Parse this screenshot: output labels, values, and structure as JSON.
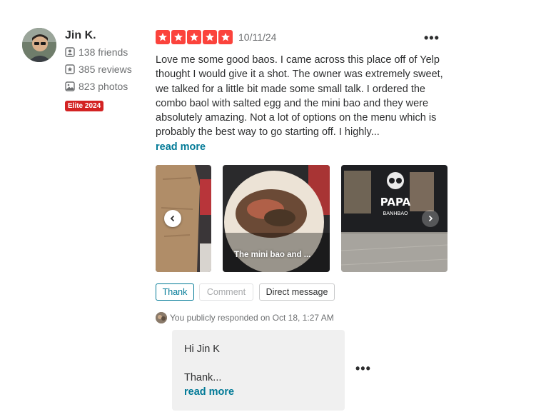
{
  "user": {
    "name": "Jin K.",
    "friends": "138 friends",
    "reviews": "385 reviews",
    "photos": "823 photos",
    "elite": "Elite 2024"
  },
  "review": {
    "rating": 5,
    "date": "10/11/24",
    "text": "Love me some good baos. I came across this place off of Yelp thought I would give it a shot. The owner was extremely sweet, we talked for a little bit made some small talk. I ordered the combo baol with salted egg and the mini bao and they were absolutely amazing. Not a lot of options on the menu which is probably the best way to go starting off. I highly...",
    "read_more": "read more"
  },
  "photos": [
    {
      "caption": ""
    },
    {
      "caption": "The mini bao and ..."
    },
    {
      "caption": ""
    }
  ],
  "sign_text": {
    "line1": "PAPA",
    "line2": "BANHBAO"
  },
  "actions": {
    "thank": "Thank",
    "comment": "Comment",
    "direct_message": "Direct message"
  },
  "response": {
    "meta": "You publicly responded on Oct 18, 1:27 AM",
    "greeting": "Hi Jin K",
    "body": "Thank...",
    "read_more": "read more"
  },
  "colors": {
    "star": "#fb433c",
    "elite": "#d32323",
    "link": "#027a97"
  }
}
